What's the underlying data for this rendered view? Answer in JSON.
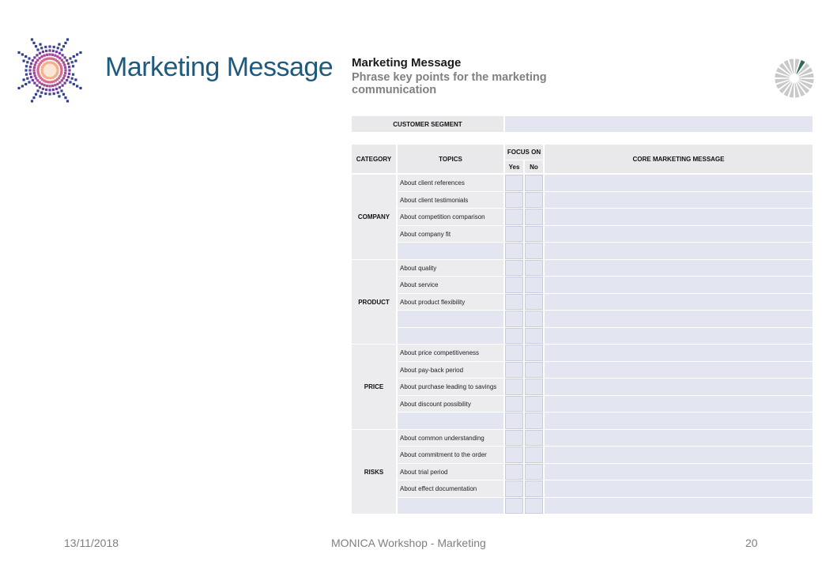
{
  "slide": {
    "title": "Marketing Message",
    "footer_date": "13/11/2018",
    "footer_center": "MONICA Workshop - Marketing",
    "page_number": "20"
  },
  "form": {
    "title": "Marketing Message",
    "subtitle": "Phrase key points for the marketing communication",
    "customer_segment_label": "CUSTOMER SEGMENT",
    "headers": {
      "category": "CATEGORY",
      "topics": "TOPICS",
      "focus_on": "FOCUS ON",
      "yes": "Yes",
      "no": "No",
      "core_message": "CORE MARKETING MESSAGE"
    },
    "categories": [
      {
        "name": "COMPANY",
        "topics": [
          "About client references",
          "About client testimonials",
          "About competition comparison",
          "About company fit",
          ""
        ]
      },
      {
        "name": "PRODUCT",
        "topics": [
          "About quality",
          "About service",
          "About product flexibility",
          "",
          ""
        ]
      },
      {
        "name": "PRICE",
        "topics": [
          "About price competitiveness",
          "About pay-back period",
          "About purchase leading to savings",
          "About discount possibility",
          ""
        ]
      },
      {
        "name": "RISKS",
        "topics": [
          "About common understanding",
          "About commitment to the order",
          "About trial period",
          "About effect documentation",
          ""
        ]
      }
    ]
  },
  "colors": {
    "title_blue": "#1f5a7d",
    "field_fill": "#e3e5f1",
    "label_fill": "#ececee"
  }
}
